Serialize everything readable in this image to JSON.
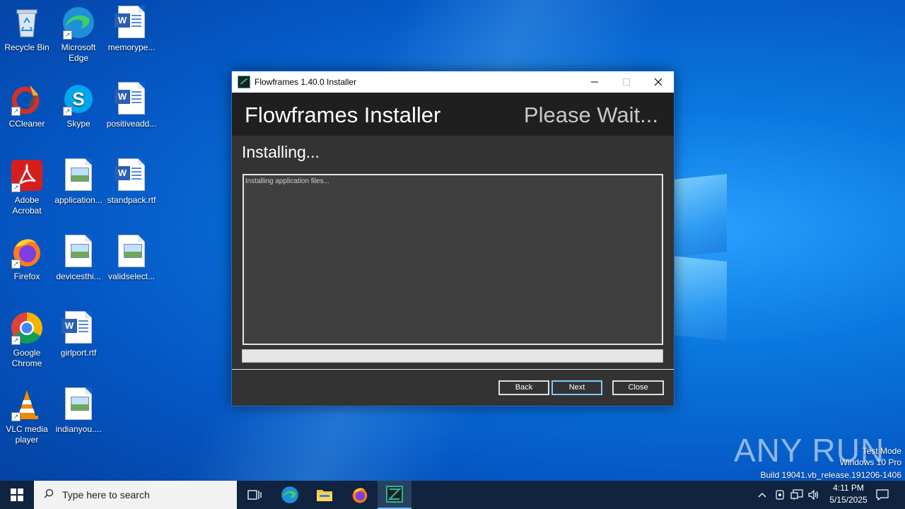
{
  "desktop": {
    "icons": [
      {
        "label": "Recycle Bin"
      },
      {
        "label": "Microsoft Edge"
      },
      {
        "label": "memorype..."
      },
      {
        "label": "CCleaner"
      },
      {
        "label": "Skype"
      },
      {
        "label": "positiveadd..."
      },
      {
        "label": "Adobe Acrobat"
      },
      {
        "label": "application..."
      },
      {
        "label": "standpack.rtf"
      },
      {
        "label": "Firefox"
      },
      {
        "label": "devicesthi..."
      },
      {
        "label": "validselect..."
      },
      {
        "label": "Google Chrome"
      },
      {
        "label": "girlport.rtf"
      },
      {
        "label": "VLC media player"
      },
      {
        "label": "indianyou...."
      }
    ]
  },
  "window": {
    "title": "Flowframes 1.40.0 Installer",
    "header_title": "Flowframes Installer",
    "header_status": "Please Wait...",
    "subtitle": "Installing...",
    "log_text": "Installing application files...",
    "progress": 0,
    "buttons": {
      "back": "Back",
      "next": "Next",
      "close": "Close"
    }
  },
  "taskbar": {
    "search_placeholder": "Type here to search",
    "time": "4:11 PM",
    "date": "5/15/2025"
  },
  "watermark": {
    "brand": "ANY RUN",
    "line1": "Test Mode",
    "line2": "Windows 10 Pro",
    "line3": "Build 19041.vb_release.191206-1406"
  },
  "colors": {
    "accent": "#1d6fd0",
    "header_bg": "#1f1f1f",
    "body_bg": "#333333"
  }
}
